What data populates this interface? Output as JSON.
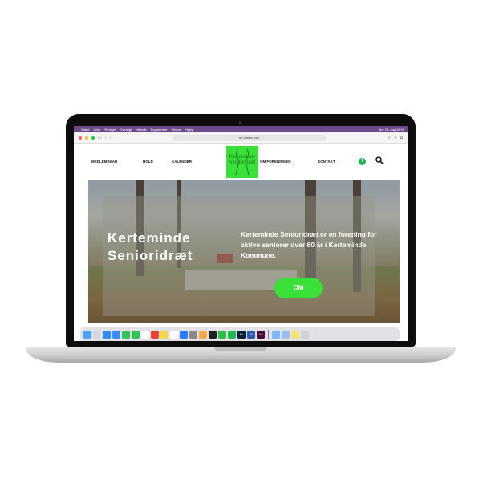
{
  "menubar": {
    "items": [
      "Safari",
      "Arkiv",
      "Rediger",
      "Oversigt",
      "Historik",
      "Bogmærker",
      "Vindue",
      "Hjælp"
    ],
    "clock": "fre. 26. maj 16.05"
  },
  "browser": {
    "url": "srt.sitebw.com"
  },
  "site": {
    "nav": [
      "MEDLEMSKAB",
      "HOLD",
      "KALENDER",
      "OM FORENINGEN",
      "KONTAKT"
    ],
    "logo_lines": [
      "Kerteminde",
      "Senioridræt"
    ],
    "facebook_glyph": "f",
    "search_glyph": "🔍"
  },
  "hero": {
    "title": "Kerteminde\nSenioridræt",
    "description": "Kerteminde Senioridræt er en forening for aktive seniorer over 60 år i Kerteminde Kommune.",
    "button_label": "OM"
  },
  "dock": {
    "apps": [
      "finder-icon",
      "launchpad-icon",
      "safari-icon",
      "mail-icon",
      "facetime-icon",
      "messages-icon",
      "calendar-icon",
      "chrome-icon",
      "notes-icon",
      "reminders-icon",
      "appstore-icon",
      "settings-icon",
      "photos-icon",
      "github-icon",
      "whatsapp-icon",
      "spotify-icon",
      "photoshop-icon",
      "word-icon",
      "xd-icon",
      "folder-icon",
      "preview-icon",
      "notes2-icon",
      "trash-icon"
    ],
    "colors": [
      "#4aa3ff",
      "#d7d7e0",
      "#2a8cff",
      "#3a8cff",
      "#33c15a",
      "#33c15a",
      "#ffffff",
      "#e94235",
      "#f2d94a",
      "#ffffff",
      "#2a7bff",
      "#8a8a8a",
      "#f6a94a",
      "#222222",
      "#2dbd4a",
      "#1db954",
      "#001e36",
      "#2b5cb0",
      "#470137",
      "#7db7ff",
      "#9bbef0",
      "#f5e27a",
      "#cfd3d8"
    ],
    "labels": [
      "Ps",
      "W",
      "Xd"
    ]
  },
  "colors": {
    "brand_green": "#3adf3a",
    "menubar_purple": "#6b4a8a"
  }
}
